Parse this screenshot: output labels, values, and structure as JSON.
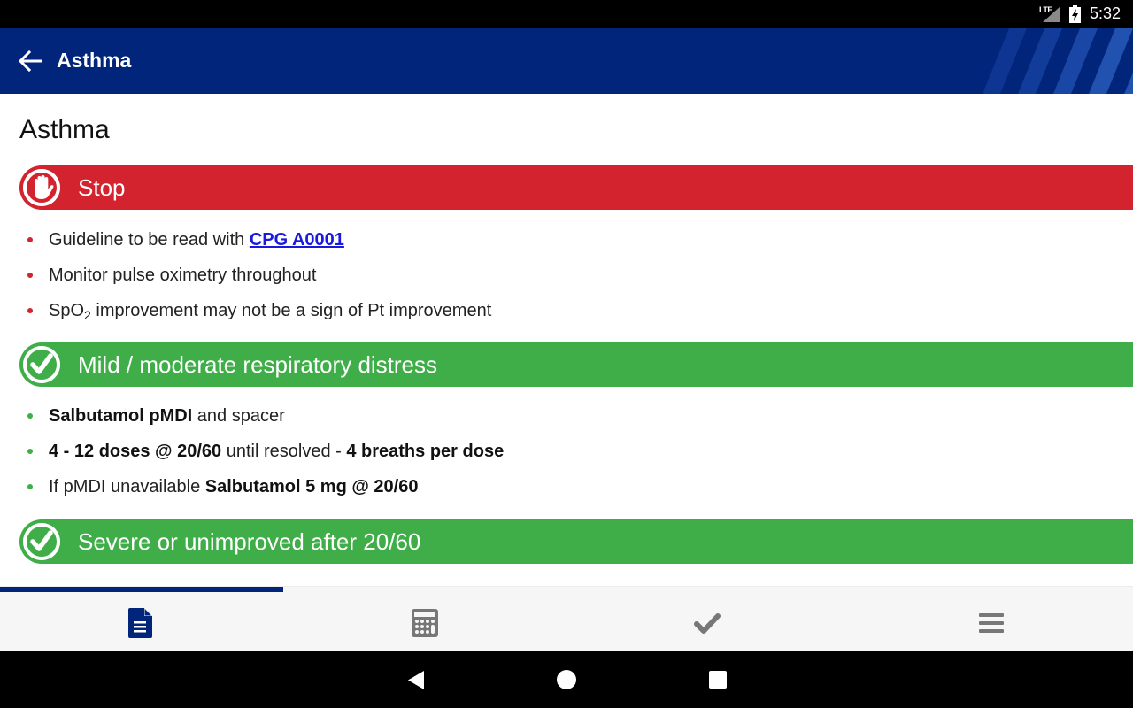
{
  "status_bar": {
    "network": "LTE",
    "time": "5:32",
    "icons": [
      "lte-signal-icon",
      "battery-charging-icon"
    ]
  },
  "app_bar": {
    "title": "Asthma",
    "back_icon": "arrow-left-icon",
    "color": "#00257a"
  },
  "page": {
    "title": "Asthma",
    "sections": [
      {
        "type": "stop",
        "label": "Stop",
        "icon": "hand-stop-icon",
        "color": "#d2232e",
        "bullets": [
          {
            "parts": [
              {
                "text": "Guideline to be read with "
              },
              {
                "text": "CPG A0001",
                "link": true
              }
            ]
          },
          {
            "parts": [
              {
                "text": "Monitor pulse oximetry throughout"
              }
            ]
          },
          {
            "parts": [
              {
                "text": "SpO"
              },
              {
                "text": "2",
                "sub": true
              },
              {
                "text": " improvement may not be a sign of Pt improvement"
              }
            ]
          }
        ]
      },
      {
        "type": "go",
        "label": "Mild / moderate respiratory distress",
        "icon": "checkmark-circle-icon",
        "color": "#3fae49",
        "bullets": [
          {
            "parts": [
              {
                "text": "Salbutamol pMDI",
                "bold": true
              },
              {
                "text": " and spacer"
              }
            ]
          },
          {
            "parts": [
              {
                "text": "4 - 12 doses @ 20/60",
                "bold": true
              },
              {
                "text": " until resolved - "
              },
              {
                "text": "4 breaths per dose",
                "bold": true
              }
            ]
          },
          {
            "parts": [
              {
                "text": "If pMDI unavailable "
              },
              {
                "text": "Salbutamol 5 mg @ 20/60",
                "bold": true
              }
            ]
          }
        ]
      },
      {
        "type": "go",
        "label": "Severe or unimproved after 20/60",
        "icon": "checkmark-circle-icon",
        "color": "#3fae49",
        "bullets": []
      }
    ]
  },
  "tab_bar": {
    "active_index": 0,
    "tabs": [
      {
        "name": "guideline",
        "icon": "document-icon",
        "active": true
      },
      {
        "name": "calculator",
        "icon": "calculator-icon",
        "active": false
      },
      {
        "name": "checklist",
        "icon": "checkmark-icon",
        "active": false
      },
      {
        "name": "menu",
        "icon": "menu-icon",
        "active": false
      }
    ],
    "active_color": "#00257a",
    "inactive_color": "#777777"
  },
  "nav_bar": {
    "buttons": [
      "back",
      "home",
      "recents"
    ]
  }
}
